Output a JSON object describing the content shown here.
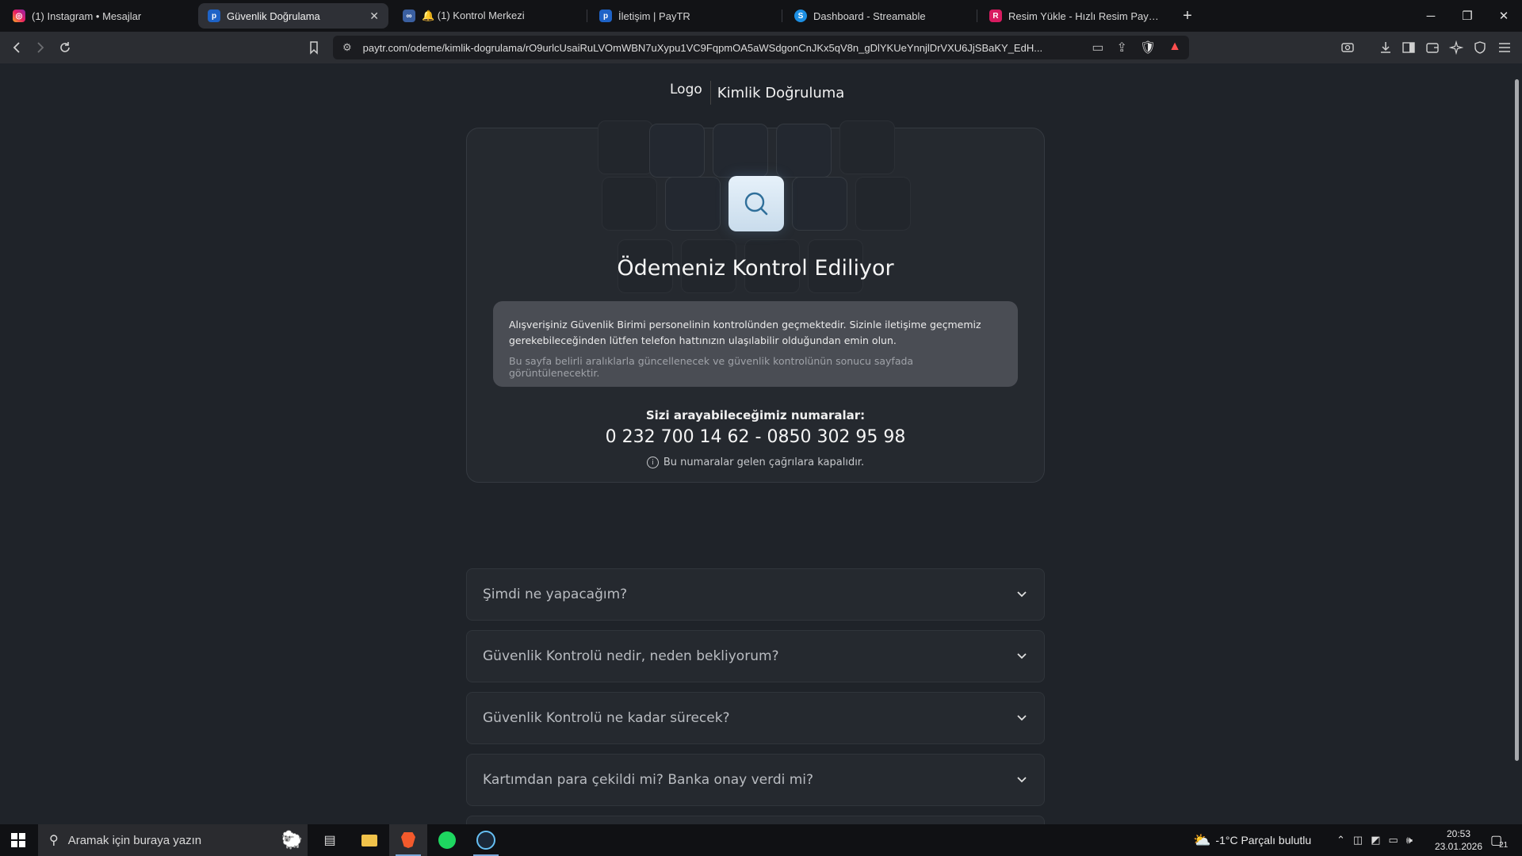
{
  "browser": {
    "tabs": [
      {
        "label": "(1) Instagram • Mesajlar",
        "favicon": "instagram-icon",
        "active": false
      },
      {
        "label": "Güvenlik Doğrulama",
        "favicon": "paytr-icon",
        "active": true
      },
      {
        "label": "🔔 (1) Kontrol Merkezi",
        "favicon": "control-center-icon",
        "active": false
      },
      {
        "label": "İletişim | PayTR",
        "favicon": "paytr-icon",
        "active": false
      },
      {
        "label": "Dashboard - Streamable",
        "favicon": "streamable-icon",
        "active": false
      },
      {
        "label": "Resim Yükle - Hızlı Resim Paylaş - Hızlı",
        "favicon": "resim-icon",
        "active": false
      }
    ],
    "url": "paytr.com/odeme/kimlik-dogrulama/rO9urlcUsaiRuLVOmWBN7uXypu1VC9FqpmOA5aWSdgonCnJKx5qV8n_gDlYKUeYnnjlDrVXU6JjSBaKY_EdH..."
  },
  "page": {
    "header": {
      "logo_alt": "Logo",
      "title": "Kimlik Doğruluma"
    },
    "card": {
      "title": "Ödemeniz Kontrol Ediliyor",
      "notice_main": "Alışverişiniz Güvenlik Birimi personelinin kontrolünden geçmektedir. Sizinle iletişime geçmemiz gerekebileceğinden lütfen telefon hattınızın ulaşılabilir olduğundan emin olun.",
      "notice_sub": "Bu sayfa belirli aralıklarla güncellenecek ve güvenlik kontrolünün sonucu sayfada görüntülenecektir.",
      "phones_label": "Sizi arayabileceğimiz numaralar:",
      "phones": "0 232 700 14 62 - 0850 302 95 98",
      "phones_note": "Bu numaralar gelen çağrılara kapalıdır."
    },
    "faq": [
      {
        "question": "Şimdi ne yapacağım?"
      },
      {
        "question": "Güvenlik Kontrolü nedir, neden bekliyorum?"
      },
      {
        "question": "Güvenlik Kontrolü ne kadar sürecek?"
      },
      {
        "question": "Kartımdan para çekildi mi? Banka onay verdi mi?"
      }
    ]
  },
  "taskbar": {
    "search_placeholder": "Aramak için buraya yazın",
    "weather": "-1°C  Parçalı bulutlu",
    "time": "20:53",
    "date": "23.01.2026",
    "notification_count": "21"
  }
}
